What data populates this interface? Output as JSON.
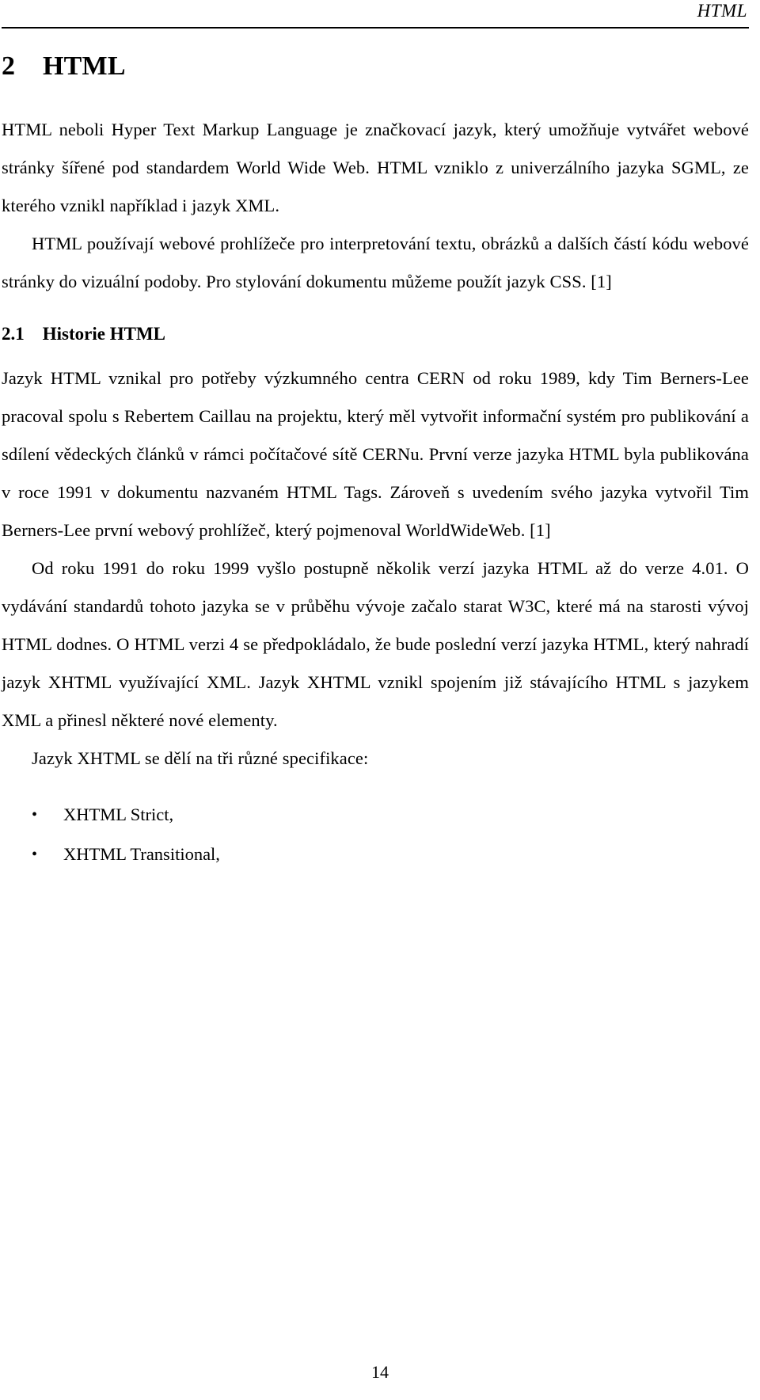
{
  "document": {
    "running_header": "HTML",
    "page_number": "14"
  },
  "chapter": {
    "number": "2",
    "title": "HTML",
    "heading_full": "2    HTML"
  },
  "paragraphs": {
    "intro_1": "HTML neboli Hyper Text Markup Language je značkovací jazyk, který umožňuje vytvářet webové stránky šířené pod standardem World Wide Web. HTML vzniklo z univerzálního jazyka SGML, ze kterého vznikl například i jazyk XML.",
    "intro_2": "HTML používají webové prohlížeče pro interpretování textu, obrázků a dalších částí kódu webové stránky do vizuální podoby. Pro stylování dokumentu můžeme použít jazyk CSS. [1]"
  },
  "section": {
    "number": "2.1",
    "title": "Historie HTML",
    "heading_full": "2.1    Historie HTML",
    "paragraphs": {
      "history_1": "Jazyk HTML vznikal pro potřeby výzkumného centra CERN od roku 1989, kdy Tim Berners-Lee pracoval spolu s Rebertem Caillau na projektu, který měl vytvořit informační systém pro publikování a sdílení vědeckých článků v rámci počítačové sítě CERNu. První verze jazyka HTML byla publikována v roce 1991 v dokumentu nazvaném HTML Tags. Zároveň s uvedením svého jazyka vytvořil Tim Berners-Lee první webový prohlížeč, který pojmenoval WorldWideWeb. [1]",
      "history_2": "Od roku 1991 do roku 1999 vyšlo postupně několik verzí jazyka HTML až do verze 4.01. O vydávání standardů tohoto jazyka se v průběhu vývoje začalo starat W3C, které má na starosti vývoj HTML dodnes. O HTML verzi 4 se předpokládalo, že bude poslední verzí jazyka HTML, který nahradí jazyk XHTML využívající XML. Jazyk XHTML vznikl spojením již stávajícího HTML s jazykem XML a přinesl některé nové elementy.",
      "history_3": "Jazyk XHTML se dělí na tři různé specifikace:"
    },
    "spec_list": {
      "bullet_glyph": "•",
      "items": [
        "XHTML Strict,",
        "XHTML Transitional,"
      ]
    }
  },
  "colors": {
    "text": "#000000",
    "rule": "#000000",
    "background": "#ffffff"
  }
}
